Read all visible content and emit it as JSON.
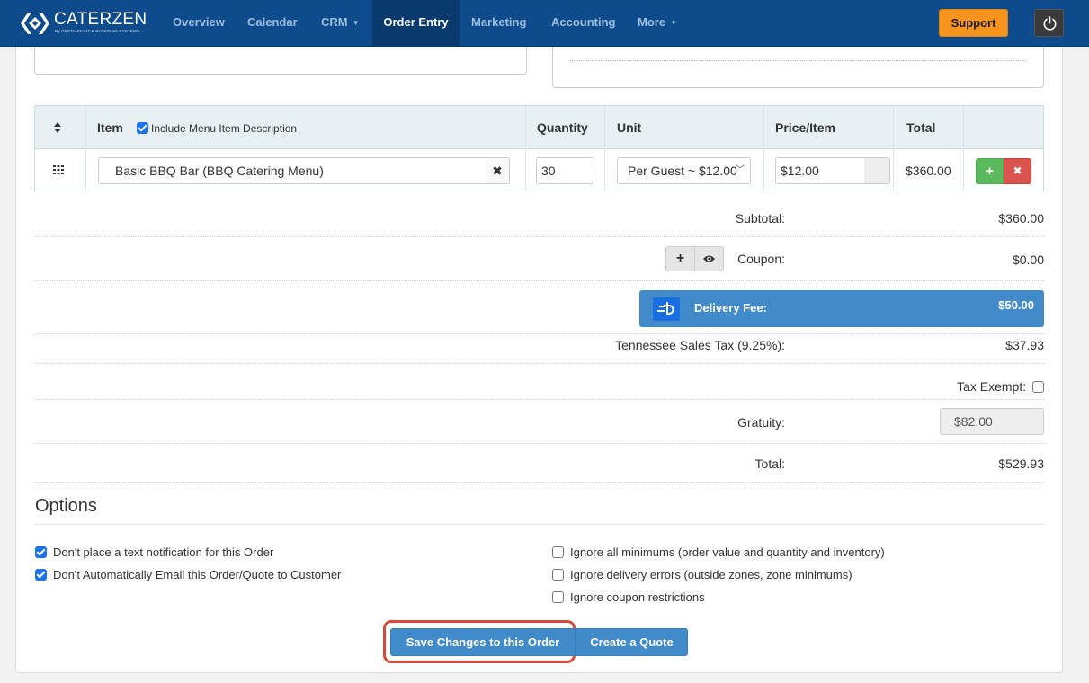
{
  "nav": {
    "logo_text": "CaterZen",
    "logo_sub": "By RESTAURANT & CATERING SYSTEMS",
    "items": [
      "Overview",
      "Calendar",
      "CRM",
      "Order Entry",
      "Marketing",
      "Accounting",
      "More"
    ],
    "support": "Support"
  },
  "table": {
    "headers": {
      "item": "Item",
      "include_desc": "Include Menu Item Description",
      "quantity": "Quantity",
      "unit": "Unit",
      "price": "Price/Item",
      "total": "Total"
    },
    "row": {
      "item": "Basic BBQ Bar (BBQ Catering Menu)",
      "quantity": "30",
      "unit": "Per Guest ~ $12.00",
      "price": "$12.00",
      "total": "$360.00"
    }
  },
  "summary": {
    "subtotal_label": "Subtotal:",
    "subtotal": "$360.00",
    "coupon_label": "Coupon:",
    "coupon": "$0.00",
    "delivery_label": "Delivery Fee:",
    "delivery": "$50.00",
    "tax_label": "Tennessee Sales Tax (9.25%):",
    "tax": "$37.93",
    "tax_exempt_label": "Tax Exempt:",
    "gratuity_label": "Gratuity:",
    "gratuity": "$82.00",
    "total_label": "Total:",
    "total": "$529.93"
  },
  "options": {
    "title": "Options",
    "left": [
      {
        "label": "Don't place a text notification for this Order",
        "checked": true
      },
      {
        "label": "Don't Automatically Email this Order/Quote to Customer",
        "checked": true
      }
    ],
    "right": [
      {
        "label": "Ignore all minimums (order value and quantity and inventory)",
        "checked": false
      },
      {
        "label": "Ignore delivery errors (outside zones, zone minimums)",
        "checked": false
      },
      {
        "label": "Ignore coupon restrictions",
        "checked": false
      }
    ]
  },
  "actions": {
    "save": "Save Changes to this Order",
    "quote": "Create a Quote"
  },
  "colors": {
    "nav": "#0d4b8c",
    "primary": "#428bca",
    "support": "#f7941d",
    "highlight": "#d6493b",
    "add": "#5cb85c",
    "delete": "#d9534f"
  }
}
